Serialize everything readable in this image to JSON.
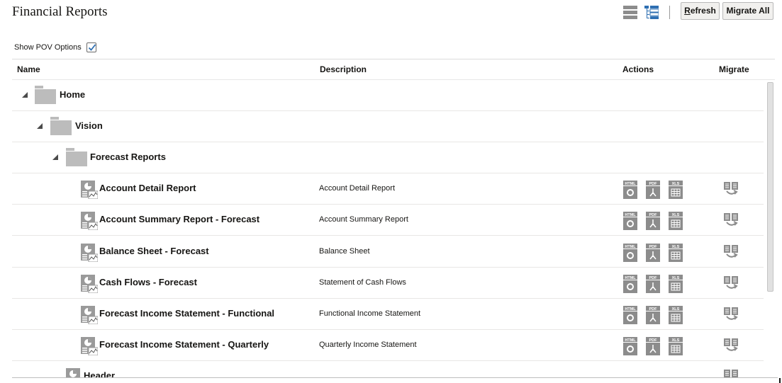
{
  "header": {
    "title": "Financial Reports",
    "refresh_label": "Refresh",
    "migrate_all_label": "Migrate All",
    "view_icons": [
      "list-view-icon",
      "tree-view-icon"
    ]
  },
  "pov": {
    "label": "Show POV Options",
    "checked": true
  },
  "columns": {
    "name": "Name",
    "description": "Description",
    "actions": "Actions",
    "migrate": "Migrate"
  },
  "rows": [
    {
      "type": "folder",
      "level": 0,
      "name": "Home",
      "description": ""
    },
    {
      "type": "folder",
      "level": 1,
      "name": "Vision",
      "description": ""
    },
    {
      "type": "folder",
      "level": 2,
      "name": "Forecast Reports",
      "description": ""
    },
    {
      "type": "report",
      "level": 3,
      "name": "Account Detail Report",
      "description": "Account Detail Report"
    },
    {
      "type": "report",
      "level": 3,
      "name": "Account Summary Report - Forecast",
      "description": "Account Summary Report"
    },
    {
      "type": "report",
      "level": 3,
      "name": "Balance Sheet - Forecast",
      "description": "Balance Sheet"
    },
    {
      "type": "report",
      "level": 3,
      "name": "Cash Flows - Forecast",
      "description": "Statement of Cash Flows"
    },
    {
      "type": "report",
      "level": 3,
      "name": "Forecast Income Statement - Functional",
      "description": "Functional Income Statement"
    },
    {
      "type": "report",
      "level": 3,
      "name": "Forecast Income Statement - Quarterly",
      "description": "Quarterly Income Statement"
    },
    {
      "type": "report",
      "level": 2,
      "name": "Header",
      "description": ""
    }
  ],
  "action_icons": {
    "html": "HTML",
    "pdf": "PDF",
    "xls": "XLS"
  },
  "colors": {
    "icon_gray": "#8c8c8c",
    "folder_gray": "#bcbcbc",
    "accent_blue": "#2e6fb2"
  }
}
